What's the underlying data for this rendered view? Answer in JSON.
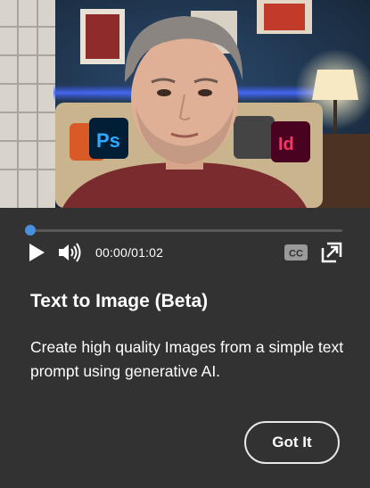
{
  "video": {
    "thumbnail_description_icon": "presenter-video-thumbnail",
    "progress_fraction": 0.0,
    "progress_color": "#1473e6",
    "timecode": "00:00/01:02",
    "controls": {
      "play_icon": "play-icon",
      "volume_icon": "volume-icon",
      "cc_icon": "closed-captions-icon",
      "pip_icon": "picture-in-picture-icon"
    }
  },
  "panel": {
    "title": "Text to Image (Beta)",
    "description": "Create high quality Images from a simple text prompt using generative AI.",
    "got_it_label": "Got It",
    "background": "#323232"
  }
}
